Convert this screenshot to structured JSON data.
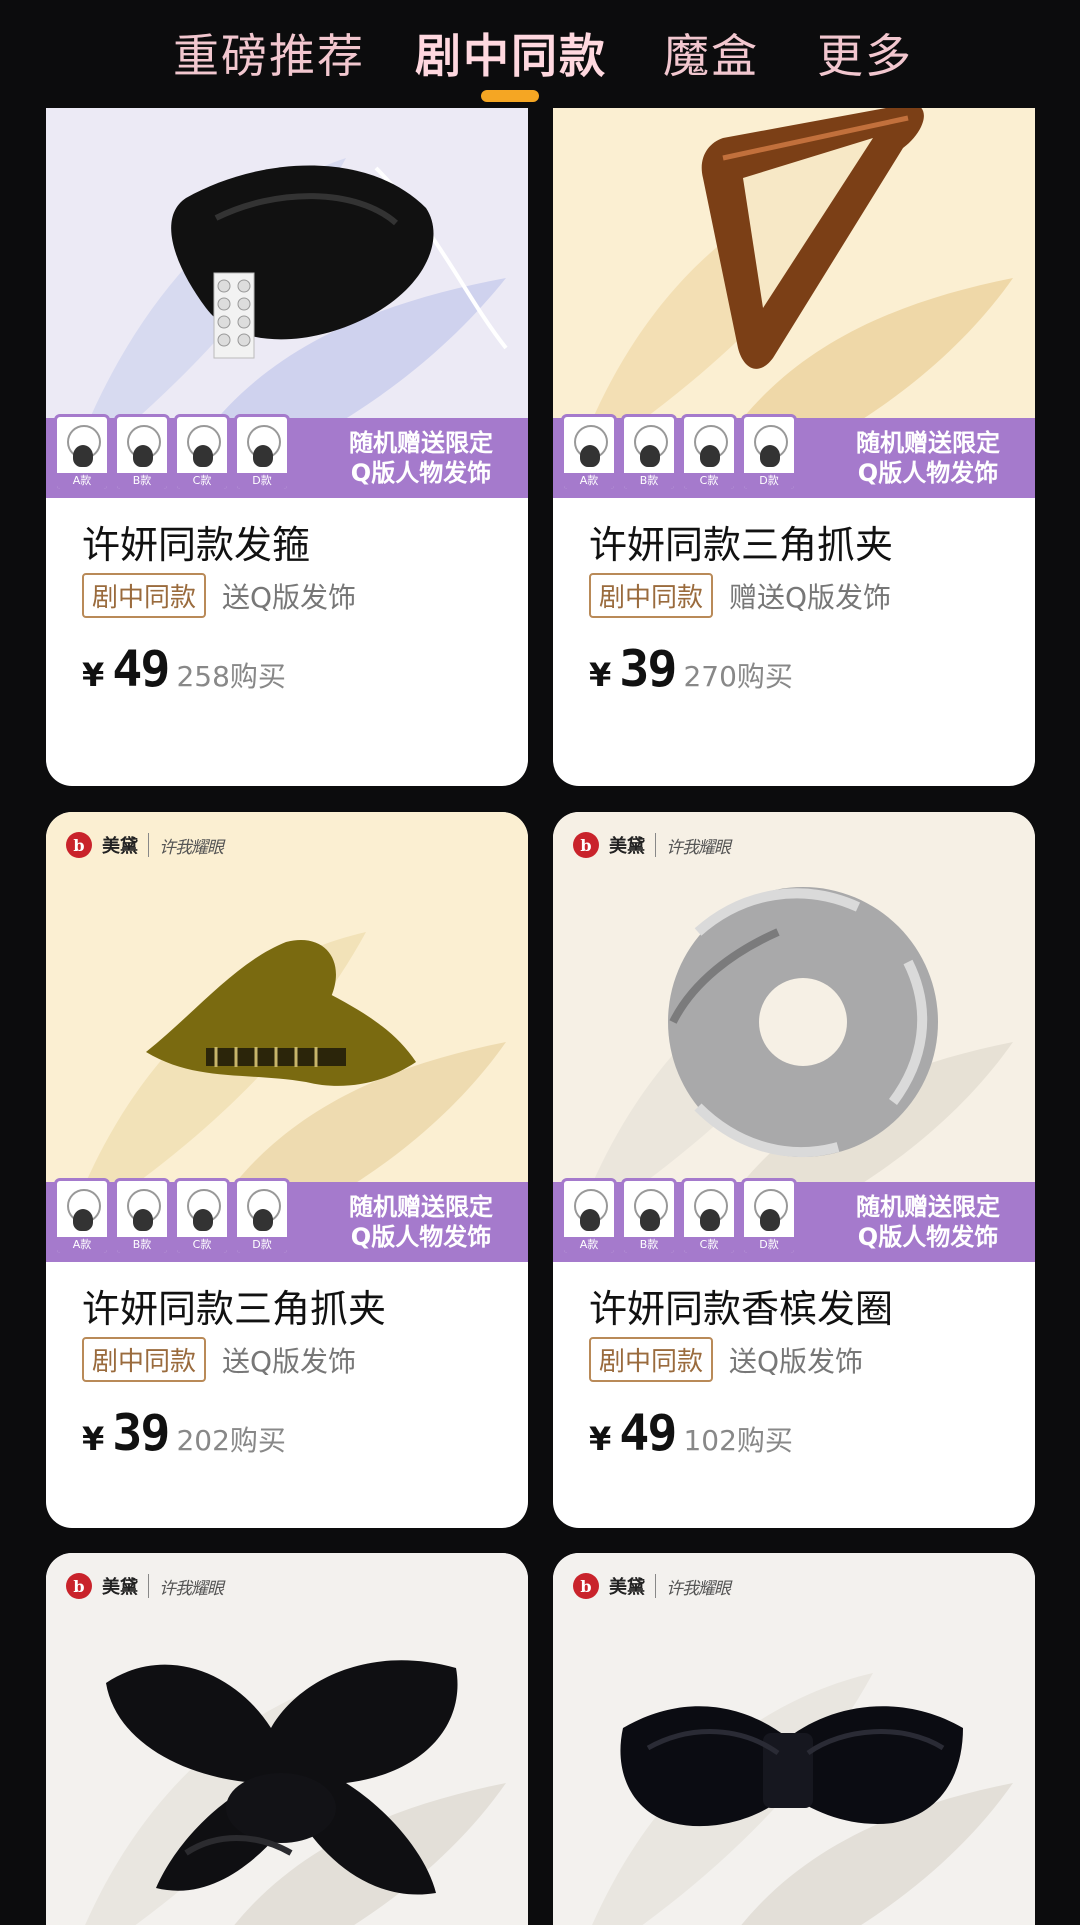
{
  "tabs": [
    {
      "label": "重磅推荐",
      "active": false
    },
    {
      "label": "剧中同款",
      "active": true
    },
    {
      "label": "魔盒",
      "active": false
    },
    {
      "label": "更多",
      "active": false
    }
  ],
  "brand": {
    "logo_mark": "b",
    "name": "美黛",
    "drama": "许我耀眼"
  },
  "promo": {
    "line1": "随机赠送限定",
    "line2": "Q版人物发饰",
    "gift_labels": [
      "A款",
      "B款",
      "C款",
      "D款"
    ]
  },
  "products": [
    {
      "title": "许妍同款发箍",
      "tag": "剧中同款",
      "gift_note": "送Q版发饰",
      "currency": "¥",
      "price": "49",
      "sales": "258购买",
      "icon": "headband-icon"
    },
    {
      "title": "许妍同款三角抓夹",
      "tag": "剧中同款",
      "gift_note": "赠送Q版发饰",
      "currency": "¥",
      "price": "39",
      "sales": "270购买",
      "icon": "claw-clip-icon"
    },
    {
      "title": "许妍同款三角抓夹",
      "tag": "剧中同款",
      "gift_note": "送Q版发饰",
      "currency": "¥",
      "price": "39",
      "sales": "202购买",
      "icon": "twist-clip-icon"
    },
    {
      "title": "许妍同款香槟发圈",
      "tag": "剧中同款",
      "gift_note": "送Q版发饰",
      "currency": "¥",
      "price": "49",
      "sales": "102购买",
      "icon": "scrunchie-icon"
    },
    {
      "title": "",
      "tag": "",
      "gift_note": "",
      "currency": "",
      "price": "",
      "sales": "",
      "icon": "bow-scrunchie-icon"
    },
    {
      "title": "",
      "tag": "",
      "gift_note": "",
      "currency": "",
      "price": "",
      "sales": "",
      "icon": "bow-clip-icon"
    }
  ],
  "colors": {
    "tab_text": "#f2c7cf",
    "indicator": "#f5a623",
    "promo": "#a57acc",
    "tag_border": "#b98a58"
  }
}
